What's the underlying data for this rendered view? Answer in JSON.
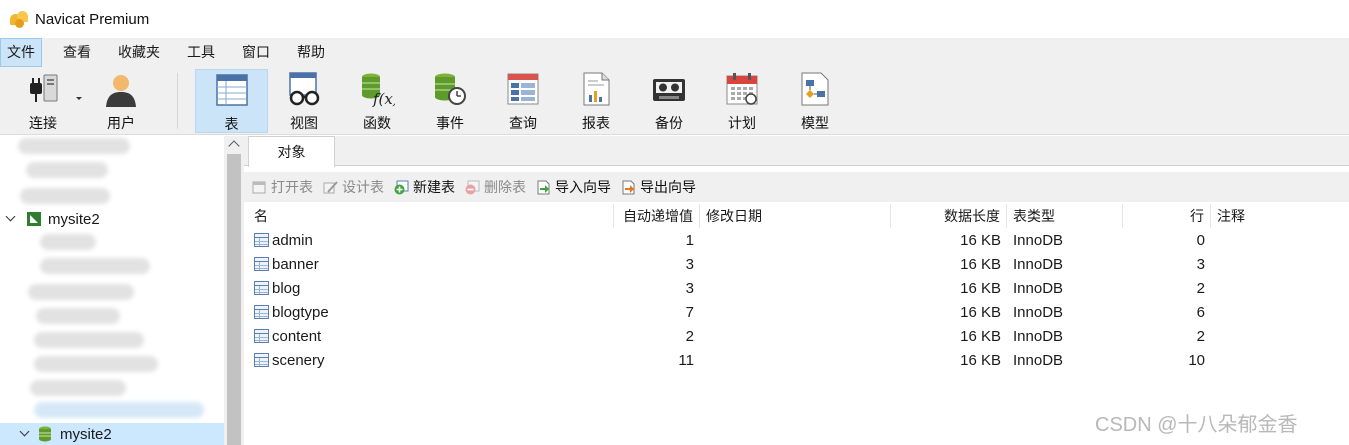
{
  "window": {
    "title": "Navicat Premium"
  },
  "menu": [
    "文件",
    "查看",
    "收藏夹",
    "工具",
    "窗口",
    "帮助"
  ],
  "toolbar": {
    "connect": "连接",
    "user": "用户",
    "table": "表",
    "view": "视图",
    "function": "函数",
    "event": "事件",
    "query": "查询",
    "report": "报表",
    "backup": "备份",
    "schedule": "计划",
    "model": "模型"
  },
  "sidebar": {
    "items": [
      {
        "label": "mysite2",
        "type": "connection",
        "expanded": true
      },
      {
        "label": "mysite2",
        "type": "database",
        "expanded": true,
        "selected": true
      }
    ]
  },
  "tabs": {
    "objects": "对象"
  },
  "actions": {
    "open_table": "打开表",
    "design_table": "设计表",
    "new_table": "新建表",
    "delete_table": "删除表",
    "import_wizard": "导入向导",
    "export_wizard": "导出向导"
  },
  "table": {
    "columns": {
      "name": "名",
      "auto_increment": "自动递增值",
      "modified": "修改日期",
      "data_length": "数据长度",
      "engine": "表类型",
      "rows": "行",
      "comment": "注释"
    },
    "rows": [
      {
        "name": "admin",
        "auto_increment": "1",
        "modified": "",
        "data_length": "16 KB",
        "engine": "InnoDB",
        "rows": "0",
        "comment": ""
      },
      {
        "name": "banner",
        "auto_increment": "3",
        "modified": "",
        "data_length": "16 KB",
        "engine": "InnoDB",
        "rows": "3",
        "comment": ""
      },
      {
        "name": "blog",
        "auto_increment": "3",
        "modified": "",
        "data_length": "16 KB",
        "engine": "InnoDB",
        "rows": "2",
        "comment": ""
      },
      {
        "name": "blogtype",
        "auto_increment": "7",
        "modified": "",
        "data_length": "16 KB",
        "engine": "InnoDB",
        "rows": "6",
        "comment": ""
      },
      {
        "name": "content",
        "auto_increment": "2",
        "modified": "",
        "data_length": "16 KB",
        "engine": "InnoDB",
        "rows": "2",
        "comment": ""
      },
      {
        "name": "scenery",
        "auto_increment": "11",
        "modified": "",
        "data_length": "16 KB",
        "engine": "InnoDB",
        "rows": "10",
        "comment": ""
      }
    ]
  },
  "watermark": "CSDN @十八朵郁金香",
  "colors": {
    "selection": "#cce4f7",
    "tree_selection": "#cce8ff",
    "chrome": "#f0f0f0"
  }
}
